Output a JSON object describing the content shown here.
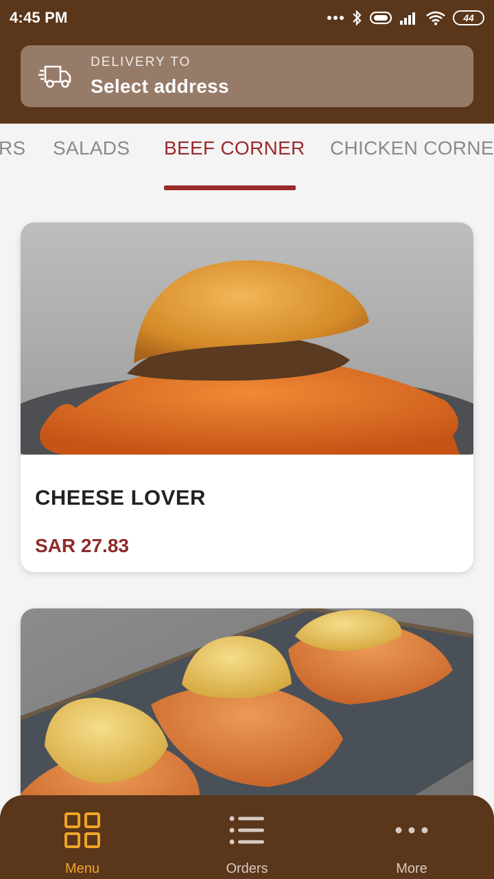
{
  "status_bar": {
    "time": "4:45 PM",
    "battery": "44",
    "icons": [
      "dots-icon",
      "bluetooth-icon",
      "vibrate-icon",
      "signal-icon",
      "wifi-icon",
      "battery-icon"
    ]
  },
  "header": {
    "delivery_caption": "DELIVERY TO",
    "address_value": "Select address",
    "icon": "delivery-truck-icon"
  },
  "tabs": [
    {
      "label": "BURGERS",
      "visible_text": "RS",
      "active": false
    },
    {
      "label": "SALADS",
      "active": false
    },
    {
      "label": "BEEF CORNER",
      "active": true
    },
    {
      "label": "CHICKEN CORNER",
      "active": false
    }
  ],
  "products": [
    {
      "name": "CHEESE LOVER",
      "price": "SAR 27.83",
      "image": "burger with crispy cheese skirt"
    },
    {
      "name": "",
      "price": "",
      "image": "three cheese sliders on plate"
    }
  ],
  "bottom_nav": [
    {
      "label": "Menu",
      "icon": "grid-icon",
      "active": true
    },
    {
      "label": "Orders",
      "icon": "list-icon",
      "active": false
    },
    {
      "label": "More",
      "icon": "more-dots-icon",
      "active": false
    }
  ],
  "colors": {
    "header_brown": "#5a361a",
    "address_box": "#977b69",
    "accent_red": "#9b2a2a",
    "nav_active": "#f0a526"
  }
}
